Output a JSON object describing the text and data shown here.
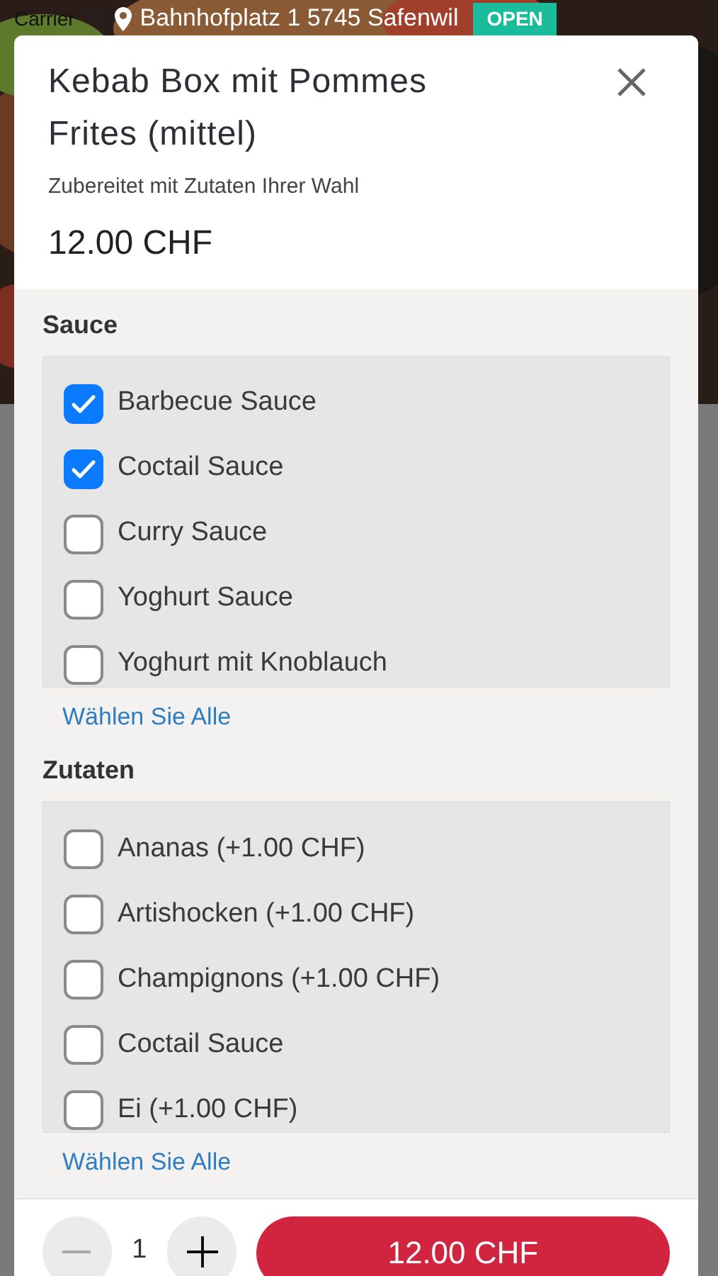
{
  "status_bar": {
    "carrier": "Carrier"
  },
  "restaurant": {
    "address": "Bahnhofplatz 1 5745 Safenwil",
    "status_badge": "OPEN"
  },
  "dialog": {
    "title": "Kebab Box mit Pommes Frites (mittel)",
    "subtitle": "Zubereitet mit Zutaten Ihrer Wahl",
    "price": "12.00 CHF",
    "groups": [
      {
        "heading": "Sauce",
        "select_all": "Wählen Sie Alle",
        "options": [
          {
            "label": "Barbecue Sauce",
            "checked": true
          },
          {
            "label": "Coctail Sauce",
            "checked": true
          },
          {
            "label": "Curry Sauce",
            "checked": false
          },
          {
            "label": "Yoghurt Sauce",
            "checked": false
          },
          {
            "label": "Yoghurt mit Knoblauch",
            "checked": false
          }
        ]
      },
      {
        "heading": "Zutaten",
        "select_all": "Wählen Sie Alle",
        "options": [
          {
            "label": "Ananas (+1.00 CHF)",
            "checked": false
          },
          {
            "label": "Artishocken (+1.00 CHF)",
            "checked": false
          },
          {
            "label": "Champignons (+1.00 CHF)",
            "checked": false
          },
          {
            "label": "Coctail Sauce",
            "checked": false
          },
          {
            "label": "Ei (+1.00 CHF)",
            "checked": false
          }
        ]
      }
    ],
    "quantity": "1",
    "add_button": "12.00 CHF"
  }
}
